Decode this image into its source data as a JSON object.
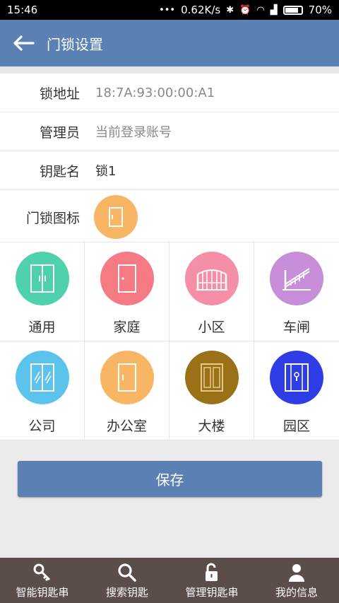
{
  "status_bar": {
    "time": "15:46",
    "net_speed": "0.62K/s",
    "battery": "70%"
  },
  "header": {
    "title": "门锁设置"
  },
  "form": {
    "lock_address": {
      "label": "锁地址",
      "value": "18:7A:93:00:00:A1"
    },
    "admin": {
      "label": "管理员",
      "value": "当前登录账号"
    },
    "key_name": {
      "label": "钥匙名",
      "value": "锁1"
    },
    "lock_icon": {
      "label": "门锁图标",
      "selected_icon": "door-icon",
      "color": "#f8b564"
    }
  },
  "icons": [
    {
      "label": "通用",
      "icon": "double-door-icon",
      "color": "#4fd1ae"
    },
    {
      "label": "家庭",
      "icon": "door-icon",
      "color": "#f57a84"
    },
    {
      "label": "小区",
      "icon": "gate-icon",
      "color": "#f58fa8"
    },
    {
      "label": "车闸",
      "icon": "barrier-icon",
      "color": "#c88dd8"
    },
    {
      "label": "公司",
      "icon": "glass-door-icon",
      "color": "#5cc4ec"
    },
    {
      "label": "办公室",
      "icon": "door-icon",
      "color": "#f8b564"
    },
    {
      "label": "大楼",
      "icon": "building-door-icon",
      "color": "#9a7117"
    },
    {
      "label": "园区",
      "icon": "park-gate-icon",
      "color": "#2f3de6"
    }
  ],
  "save_button": {
    "label": "保存"
  },
  "tabbar": [
    {
      "label": "智能钥匙串",
      "icon": "key-icon"
    },
    {
      "label": "搜索钥匙",
      "icon": "search-icon"
    },
    {
      "label": "管理钥匙串",
      "icon": "unlock-icon"
    },
    {
      "label": "我的信息",
      "icon": "user-icon"
    }
  ],
  "colors": {
    "primary": "#5b80b4",
    "tabbar": "#5a4d4a"
  }
}
